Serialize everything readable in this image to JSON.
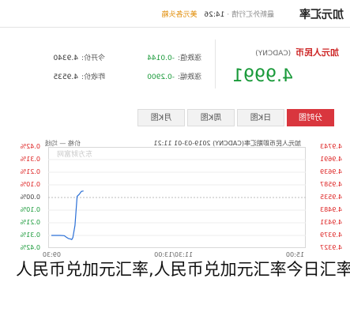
{
  "header": {
    "page_title": "加元汇率",
    "meta_prefix": "最新外汇行情 ·",
    "meta_time": "14:26",
    "meta_flag": "美元各头箱"
  },
  "quote": {
    "pair_name": "加元人民币",
    "pair_code": "(CADCNY)",
    "price": "4.9991",
    "stats": [
      {
        "label": "涨跌值:",
        "value": "-0.0144"
      },
      {
        "label": "今开价:",
        "value": "4.9340"
      },
      {
        "label": "涨跌幅:",
        "value": "-0.2900"
      },
      {
        "label": "昨收价:",
        "value": "4.9535"
      }
    ]
  },
  "tabs": [
    "分时图",
    "日K图",
    "周K图",
    "月K图"
  ],
  "chart": {
    "header_text": "加元人民币即期汇率(CADCNY) 2019-03-01 11:21",
    "legend_tag": "价格 — 均线",
    "watermark": "东方财富网"
  },
  "chart_data": {
    "type": "line",
    "price_ticks": [
      "4.9743",
      "4.9691",
      "4.9639",
      "4.9587",
      "4.9535",
      "4.9483",
      "4.9431",
      "4.9379",
      "4.9327"
    ],
    "pct_ticks": [
      "0.42%",
      "0.31%",
      "0.21%",
      "0.10%",
      "0.00%",
      "0.10%",
      "0.21%",
      "0.31%",
      "0.42%"
    ],
    "ylim": [
      4.9327,
      4.9743
    ],
    "x_ticks": [
      "09:30",
      "11:30/13:00",
      "15:00"
    ],
    "series": [
      {
        "x": [
          0,
          4,
          8,
          12,
          14,
          16,
          18,
          19,
          20,
          22,
          24,
          26,
          28,
          30
        ],
        "values": [
          4.9379,
          4.9379,
          4.9379,
          4.9378,
          4.9372,
          4.9366,
          4.9364,
          4.9362,
          4.937,
          4.942,
          4.954,
          4.9548,
          4.956,
          4.9562
        ]
      }
    ],
    "x_max": 240
  },
  "caption": {
    "text": "人民币兑加元汇率,人民币兑加元汇率今日汇率"
  }
}
